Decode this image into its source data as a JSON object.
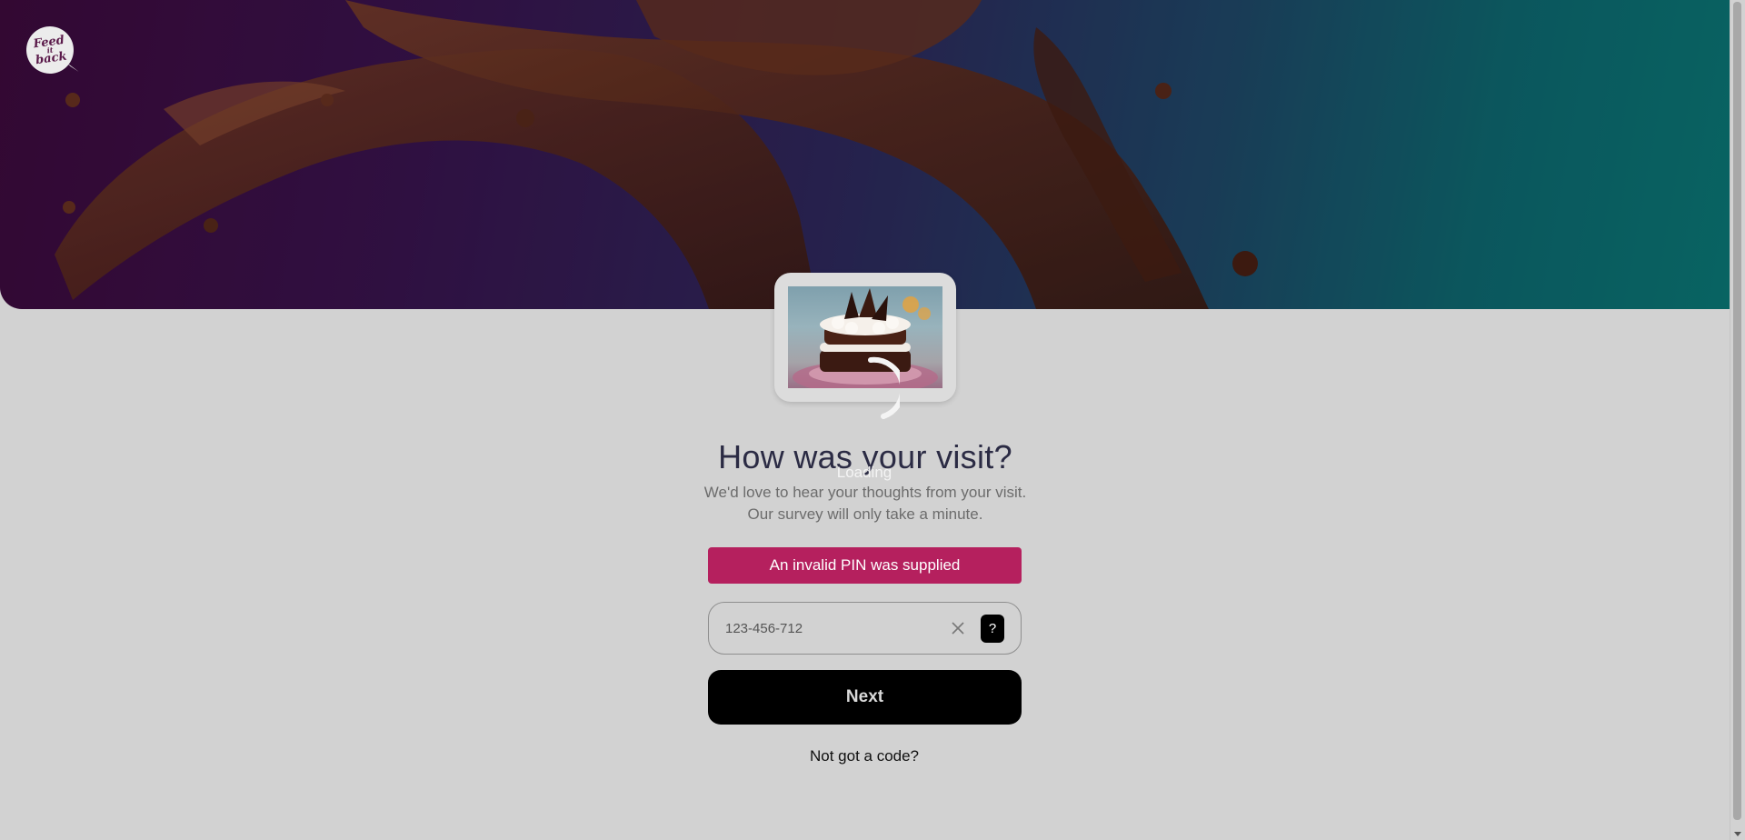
{
  "header": {
    "logo_line1": "Feed",
    "logo_line2": "it",
    "logo_line3": "back"
  },
  "loading": {
    "text": "Loading"
  },
  "main": {
    "title": "How was your visit?",
    "subtitle": "We'd love to hear your thoughts from your visit. Our survey will only take a minute.",
    "error_message": "An invalid PIN was supplied",
    "pin_value": "123-456-712",
    "help_label": "?",
    "next_label": "Next",
    "no_code_label": "Not got a code?"
  },
  "colors": {
    "error": "#b5205e",
    "button": "#000000",
    "background": "#d2d2d2"
  }
}
